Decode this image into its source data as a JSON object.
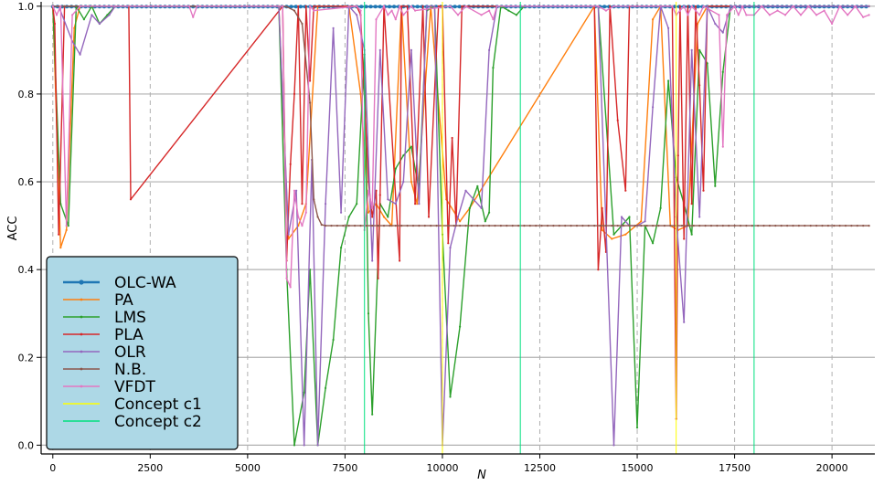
{
  "chart_data": {
    "type": "line",
    "xlabel": "N",
    "ylabel": "ACC",
    "xlim": [
      -300,
      21100
    ],
    "ylim": [
      -0.02,
      1.01
    ],
    "x_ticks": [
      0,
      2500,
      5000,
      7500,
      10000,
      12500,
      15000,
      17500,
      20000
    ],
    "y_ticks": [
      0.0,
      0.2,
      0.4,
      0.6,
      0.8,
      1.0
    ],
    "grid": "horizontal",
    "legend_position": "lower-left",
    "legend_bg": "#add8e6",
    "dashed_vlines": [
      0,
      2500,
      5000,
      7500,
      10000,
      12500,
      15000,
      17500,
      20000
    ],
    "concept_c1_lines": [
      10000,
      16000
    ],
    "concept_c2_lines": [
      8000,
      12000,
      18000
    ],
    "series": [
      {
        "name": "OLC-WA",
        "color": "#1f77b4",
        "width": 2.2,
        "marker": 2.0,
        "x": [
          0,
          20950
        ],
        "y": [
          0.999,
          0.999
        ],
        "dense": true
      },
      {
        "name": "PA",
        "color": "#ff7f0e",
        "width": 1.4,
        "x": [
          0,
          200,
          350,
          550,
          700,
          5800,
          6050,
          6300,
          6500,
          6800,
          7600,
          7900,
          8100,
          8300,
          8500,
          8700,
          8950,
          9200,
          9350,
          9700,
          10100,
          10450,
          10700,
          13900,
          14100,
          14350,
          14700,
          15100,
          15400,
          15600,
          15850,
          16050,
          16300,
          16550,
          16800,
          20950
        ],
        "y": [
          1.0,
          0.45,
          0.49,
          0.95,
          1.0,
          1.0,
          0.47,
          0.5,
          0.55,
          1.0,
          1.0,
          0.8,
          0.53,
          0.55,
          0.52,
          0.5,
          1.0,
          0.6,
          0.55,
          1.0,
          0.56,
          0.51,
          0.54,
          1.0,
          0.49,
          0.47,
          0.48,
          0.51,
          0.97,
          1.0,
          0.5,
          0.49,
          0.5,
          0.96,
          1.0,
          1.0
        ]
      },
      {
        "name": "LMS",
        "color": "#2ca02c",
        "width": 1.4,
        "x": [
          0,
          200,
          400,
          600,
          800,
          1000,
          1200,
          1400,
          1600,
          1800,
          5800,
          6000,
          6200,
          6450,
          6600,
          6800,
          7000,
          7200,
          7400,
          7600,
          7800,
          8000,
          8100,
          8200,
          8400,
          8600,
          8800,
          9000,
          9200,
          9400,
          9600,
          9800,
          10000,
          10200,
          10450,
          10700,
          10900,
          11100,
          11200,
          11300,
          11500,
          11700,
          11900,
          12100,
          14000,
          14400,
          14600,
          14800,
          15000,
          15200,
          15400,
          15600,
          15800,
          16000,
          16200,
          16400,
          16600,
          16800,
          17000,
          17200,
          17400,
          20950
        ],
        "y": [
          1.0,
          0.55,
          0.5,
          1.0,
          0.97,
          1.0,
          0.96,
          0.98,
          1.0,
          1.0,
          1.0,
          0.4,
          0.0,
          0.12,
          0.4,
          0.0,
          0.13,
          0.24,
          0.45,
          0.52,
          0.55,
          0.89,
          0.3,
          0.07,
          0.55,
          0.52,
          0.63,
          0.66,
          0.68,
          0.58,
          0.99,
          1.0,
          0.48,
          0.11,
          0.27,
          0.54,
          0.59,
          0.51,
          0.53,
          0.86,
          1.0,
          0.99,
          0.98,
          1.0,
          1.0,
          0.48,
          0.5,
          0.52,
          0.04,
          0.5,
          0.46,
          0.54,
          0.83,
          0.61,
          0.55,
          0.48,
          0.9,
          0.87,
          0.59,
          0.85,
          1.0,
          1.0
        ]
      },
      {
        "name": "PLA",
        "color": "#d62728",
        "width": 1.4,
        "x": [
          0,
          50,
          150,
          300,
          1950,
          2000,
          5900,
          6000,
          6100,
          6200,
          6300,
          6400,
          6500,
          6600,
          6700,
          7800,
          7900,
          8100,
          8200,
          8300,
          8350,
          8400,
          8500,
          8900,
          8950,
          9100,
          9300,
          9500,
          9650,
          9900,
          10000,
          10150,
          10250,
          10350,
          10500,
          13900,
          14000,
          14100,
          14200,
          14300,
          14500,
          14700,
          14800,
          15000,
          15900,
          16000,
          16050,
          16100,
          16200,
          16300,
          16400,
          16500,
          16600,
          16700,
          16800,
          20950
        ],
        "y": [
          1.0,
          0.96,
          0.48,
          1.0,
          1.0,
          0.56,
          1.0,
          0.42,
          0.64,
          0.8,
          1.0,
          0.55,
          1.0,
          0.83,
          1.0,
          1.0,
          0.98,
          0.6,
          0.52,
          0.58,
          0.38,
          0.57,
          1.0,
          0.42,
          1.0,
          1.0,
          0.55,
          1.0,
          0.52,
          1.0,
          1.0,
          0.46,
          0.7,
          0.5,
          1.0,
          1.0,
          0.4,
          0.54,
          0.44,
          1.0,
          0.74,
          0.58,
          1.0,
          1.0,
          1.0,
          0.06,
          0.66,
          1.0,
          0.47,
          1.0,
          0.55,
          1.0,
          0.82,
          0.58,
          1.0,
          1.0
        ]
      },
      {
        "name": "OLR",
        "color": "#9467bd",
        "width": 1.4,
        "x": [
          0,
          150,
          500,
          700,
          1000,
          1200,
          1450,
          1600,
          5800,
          6050,
          6250,
          6450,
          6650,
          6800,
          7000,
          7200,
          7400,
          7600,
          7800,
          8000,
          8200,
          8400,
          8600,
          8800,
          9000,
          9200,
          9400,
          9600,
          9800,
          10000,
          10200,
          10400,
          10600,
          10800,
          11000,
          11200,
          11400,
          14000,
          14200,
          14400,
          14600,
          14800,
          15000,
          15200,
          15400,
          15600,
          15800,
          16000,
          16200,
          16400,
          16600,
          16800,
          17000,
          17200,
          17400,
          20950
        ],
        "y": [
          1.0,
          1.0,
          0.92,
          0.89,
          0.98,
          0.96,
          0.98,
          1.0,
          1.0,
          0.48,
          0.58,
          0.0,
          0.65,
          0.0,
          0.55,
          0.95,
          0.53,
          1.0,
          0.98,
          0.9,
          0.42,
          0.9,
          0.56,
          0.55,
          0.6,
          0.9,
          0.55,
          1.0,
          1.0,
          0.0,
          0.45,
          0.52,
          0.58,
          0.56,
          0.54,
          0.9,
          1.0,
          1.0,
          0.5,
          0.0,
          0.52,
          0.5,
          0.5,
          0.51,
          0.77,
          1.0,
          0.95,
          0.52,
          0.28,
          0.9,
          0.52,
          1.0,
          0.96,
          0.94,
          1.0,
          1.0
        ]
      },
      {
        "name": "N.B.",
        "color": "#8c564b",
        "width": 1.4,
        "x": [
          0,
          5900,
          6000,
          6200,
          6400,
          6600,
          6700,
          6800,
          6900,
          7000,
          20950
        ],
        "y": [
          1.0,
          1.0,
          0.999,
          0.99,
          0.96,
          0.78,
          0.56,
          0.52,
          0.502,
          0.5,
          0.5
        ],
        "noise": 0.002
      },
      {
        "name": "VFDT",
        "color": "#e377c2",
        "width": 1.4,
        "x": [
          0,
          100,
          200,
          350,
          500,
          700,
          3500,
          3600,
          3700,
          5900,
          6000,
          6100,
          6200,
          6300,
          6400,
          6500,
          6600,
          6700,
          7800,
          7900,
          8000,
          8100,
          8200,
          8300,
          8500,
          8600,
          8700,
          8800,
          8900,
          9000,
          9200,
          9300,
          10200,
          10400,
          10600,
          11000,
          11200,
          11300,
          11400,
          14000,
          14200,
          14400,
          15900,
          16000,
          16100,
          16200,
          16300,
          16400,
          16500,
          16600,
          16700,
          17100,
          17200,
          17300,
          17500,
          17600,
          17700,
          17800,
          18000,
          18200,
          18400,
          18600,
          18800,
          19000,
          19200,
          19400,
          19600,
          19800,
          20000,
          20200,
          20400,
          20600,
          20800,
          20950
        ],
        "y": [
          1.0,
          0.98,
          1.0,
          0.5,
          0.98,
          1.0,
          1.0,
          0.975,
          1.0,
          1.0,
          0.38,
          0.36,
          0.58,
          0.52,
          0.5,
          0.53,
          1.0,
          0.99,
          1.0,
          0.99,
          0.49,
          0.58,
          0.54,
          0.97,
          1.0,
          0.98,
          0.99,
          0.97,
          1.0,
          0.98,
          1.0,
          0.99,
          1.0,
          0.98,
          1.0,
          0.98,
          0.99,
          0.97,
          1.0,
          1.0,
          0.99,
          1.0,
          1.0,
          0.98,
          0.99,
          1.0,
          0.98,
          1.0,
          0.99,
          0.98,
          1.0,
          0.98,
          0.68,
          0.98,
          1.0,
          0.98,
          1.0,
          0.98,
          0.98,
          1.0,
          0.98,
          0.99,
          0.98,
          1.0,
          0.98,
          1.0,
          0.98,
          0.99,
          0.96,
          1.0,
          0.98,
          1.0,
          0.975,
          0.98
        ]
      },
      {
        "name": "Concept c1",
        "color": "#ffff00",
        "width": 1.0,
        "legend_only": true
      },
      {
        "name": "Concept c2",
        "color": "#00e07f",
        "width": 1.0,
        "legend_only": true
      }
    ]
  }
}
